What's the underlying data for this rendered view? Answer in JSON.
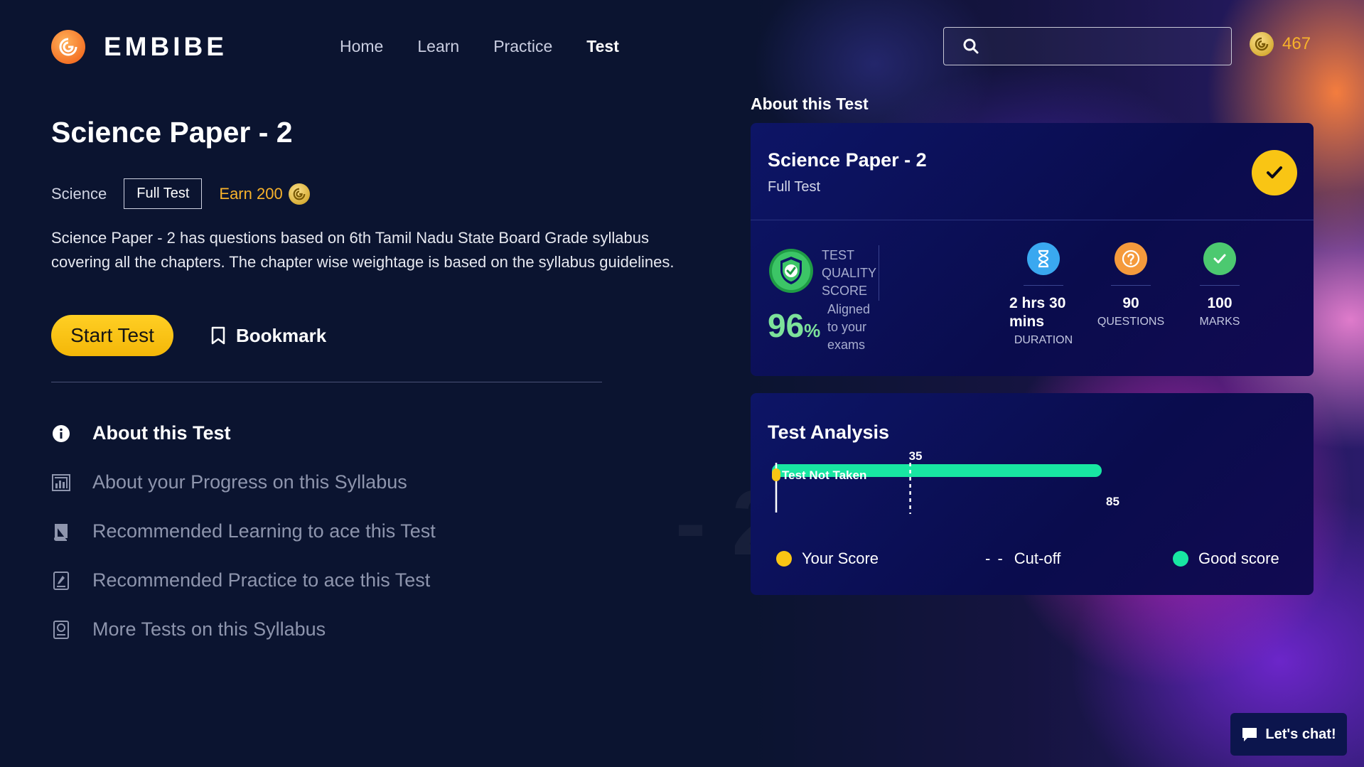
{
  "header": {
    "logo_text": "EMBIBE",
    "nav": [
      {
        "label": "Home",
        "active": false
      },
      {
        "label": "Learn",
        "active": false
      },
      {
        "label": "Practice",
        "active": false
      },
      {
        "label": "Test",
        "active": true
      }
    ],
    "search_placeholder": "",
    "coins": "467"
  },
  "test": {
    "title": "Science Paper - 2",
    "subject": "Science",
    "type_tag": "Full Test",
    "earn_label": "Earn 200",
    "description": "Science Paper - 2 has questions based on 6th Tamil Nadu State Board Grade syllabus covering all the chapters. The chapter wise weightage is based on the syllabus guidelines.",
    "start_button": "Start Test",
    "bookmark_button": "Bookmark"
  },
  "side_menu": [
    {
      "label": "About this Test",
      "icon": "info-icon",
      "active": true
    },
    {
      "label": "About your Progress on this Syllabus",
      "icon": "progress-chart-icon",
      "active": false
    },
    {
      "label": "Recommended Learning to ace this Test",
      "icon": "book-icon",
      "active": false
    },
    {
      "label": "Recommended Practice to ace this Test",
      "icon": "practice-sheet-icon",
      "active": false
    },
    {
      "label": "More Tests on this Syllabus",
      "icon": "test-sheet-icon",
      "active": false
    }
  ],
  "about_card": {
    "heading": "About this Test",
    "title": "Science Paper - 2",
    "subtitle": "Full Test",
    "quality_label_lines": [
      "TEST",
      "QUALITY",
      "SCORE"
    ],
    "quality_percent": "96",
    "percent_sign": "%",
    "aligned_lines": [
      "Aligned",
      "to your",
      "exams"
    ],
    "stats": [
      {
        "value_lines": [
          "2 hrs 30",
          "mins"
        ],
        "label": "DURATION",
        "icon": "hourglass-icon",
        "color": "#3aa8f0"
      },
      {
        "value_lines": [
          "90"
        ],
        "label": "QUESTIONS",
        "icon": "question-icon",
        "color": "#f59a3c"
      },
      {
        "value_lines": [
          "100"
        ],
        "label": "MARKS",
        "icon": "check-circle-icon",
        "color": "#4cc970"
      }
    ]
  },
  "analysis": {
    "title": "Test Analysis",
    "your_score_label": "Test Not Taken",
    "legend": {
      "your_score": "Your Score",
      "cutoff": "Cut-off",
      "good_score": "Good score"
    }
  },
  "chart_data": {
    "type": "bar",
    "cutoff": 35,
    "good_score": 85,
    "your_score": null,
    "xlim": [
      0,
      100
    ],
    "tick_labels": {
      "cutoff": "35",
      "good_score": "85"
    }
  },
  "colors": {
    "accent_yellow": "#f9c514",
    "good_score_green": "#18e6a2",
    "coin_gold": "#f7b22b",
    "card_navy": "#0d1566"
  },
  "chat_button": "Let's chat!"
}
